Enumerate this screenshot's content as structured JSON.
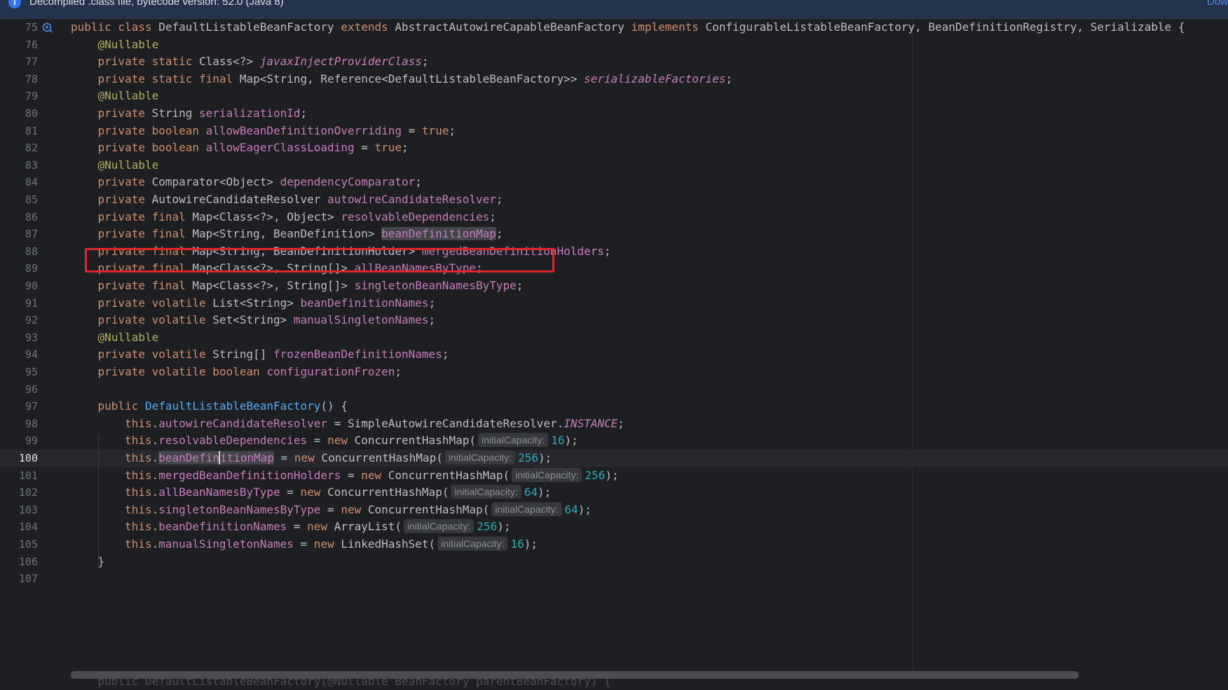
{
  "banner": {
    "icon": "info-icon",
    "text": "Decompiled .class file, bytecode version: 52.0 (Java 8)",
    "link": "Dow"
  },
  "editor": {
    "current_line": 100,
    "lines": [
      {
        "n": "75",
        "icon": true,
        "t": [
          [
            "kw",
            "public class "
          ],
          [
            "",
            "DefaultListableBeanFactory "
          ],
          [
            "kw",
            "extends "
          ],
          [
            "",
            "AbstractAutowireCapableBeanFactory "
          ],
          [
            "kw",
            "implements "
          ],
          [
            "",
            "ConfigurableListableBeanFactory, BeanDefinitionRegistry, Serializable {"
          ]
        ]
      },
      {
        "n": "76",
        "t": [
          [
            "",
            "    "
          ],
          [
            "ann",
            "@Nullable"
          ]
        ]
      },
      {
        "n": "77",
        "t": [
          [
            "",
            "    "
          ],
          [
            "kw",
            "private static "
          ],
          [
            "",
            "Class<?> "
          ],
          [
            "sfld",
            "javaxInjectProviderClass"
          ],
          [
            "",
            ";"
          ]
        ]
      },
      {
        "n": "78",
        "t": [
          [
            "",
            "    "
          ],
          [
            "kw",
            "private static final "
          ],
          [
            "",
            "Map<String, Reference<DefaultListableBeanFactory>> "
          ],
          [
            "sfld",
            "serializableFactories"
          ],
          [
            "",
            ";"
          ]
        ]
      },
      {
        "n": "79",
        "t": [
          [
            "",
            "    "
          ],
          [
            "ann",
            "@Nullable"
          ]
        ]
      },
      {
        "n": "80",
        "t": [
          [
            "",
            "    "
          ],
          [
            "kw",
            "private "
          ],
          [
            "",
            "String "
          ],
          [
            "fld",
            "serializationId"
          ],
          [
            "",
            ";"
          ]
        ]
      },
      {
        "n": "81",
        "t": [
          [
            "",
            "    "
          ],
          [
            "kw",
            "private boolean "
          ],
          [
            "fld",
            "allowBeanDefinitionOverriding"
          ],
          [
            "",
            " = "
          ],
          [
            "kw",
            "true"
          ],
          [
            "",
            ";"
          ]
        ]
      },
      {
        "n": "82",
        "t": [
          [
            "",
            "    "
          ],
          [
            "kw",
            "private boolean "
          ],
          [
            "fld",
            "allowEagerClassLoading"
          ],
          [
            "",
            " = "
          ],
          [
            "kw",
            "true"
          ],
          [
            "",
            ";"
          ]
        ]
      },
      {
        "n": "83",
        "t": [
          [
            "",
            "    "
          ],
          [
            "ann",
            "@Nullable"
          ]
        ]
      },
      {
        "n": "84",
        "t": [
          [
            "",
            "    "
          ],
          [
            "kw",
            "private "
          ],
          [
            "",
            "Comparator<Object> "
          ],
          [
            "fld",
            "dependencyComparator"
          ],
          [
            "",
            ";"
          ]
        ]
      },
      {
        "n": "85",
        "t": [
          [
            "",
            "    "
          ],
          [
            "kw",
            "private "
          ],
          [
            "",
            "AutowireCandidateResolver "
          ],
          [
            "fld",
            "autowireCandidateResolver"
          ],
          [
            "",
            ";"
          ]
        ]
      },
      {
        "n": "86",
        "t": [
          [
            "",
            "    "
          ],
          [
            "kw",
            "private final "
          ],
          [
            "",
            "Map<Class<?>, Object> "
          ],
          [
            "fld",
            "resolvableDependencies"
          ],
          [
            "",
            ";"
          ]
        ]
      },
      {
        "n": "87",
        "t": [
          [
            "",
            "    "
          ],
          [
            "kw",
            "private final "
          ],
          [
            "",
            "Map<String, BeanDefinition> "
          ],
          [
            "fld hl",
            "beanDefinitionMap"
          ],
          [
            "",
            ";"
          ]
        ]
      },
      {
        "n": "88",
        "t": [
          [
            "",
            "    "
          ],
          [
            "kw",
            "private final "
          ],
          [
            "",
            "Map<String, BeanDefinitionHolder> "
          ],
          [
            "fld",
            "mergedBeanDefinitionHolders"
          ],
          [
            "",
            ";"
          ]
        ]
      },
      {
        "n": "89",
        "t": [
          [
            "",
            "    "
          ],
          [
            "kw",
            "private final "
          ],
          [
            "",
            "Map<Class<?>, String[]> "
          ],
          [
            "fld",
            "allBeanNamesByType"
          ],
          [
            "",
            ";"
          ]
        ]
      },
      {
        "n": "90",
        "t": [
          [
            "",
            "    "
          ],
          [
            "kw",
            "private final "
          ],
          [
            "",
            "Map<Class<?>, String[]> "
          ],
          [
            "fld",
            "singletonBeanNamesByType"
          ],
          [
            "",
            ";"
          ]
        ]
      },
      {
        "n": "91",
        "t": [
          [
            "",
            "    "
          ],
          [
            "kw",
            "private volatile "
          ],
          [
            "",
            "List<String> "
          ],
          [
            "fld",
            "beanDefinitionNames"
          ],
          [
            "",
            ";"
          ]
        ]
      },
      {
        "n": "92",
        "t": [
          [
            "",
            "    "
          ],
          [
            "kw",
            "private volatile "
          ],
          [
            "",
            "Set<String> "
          ],
          [
            "fld",
            "manualSingletonNames"
          ],
          [
            "",
            ";"
          ]
        ]
      },
      {
        "n": "93",
        "t": [
          [
            "",
            "    "
          ],
          [
            "ann",
            "@Nullable"
          ]
        ]
      },
      {
        "n": "94",
        "t": [
          [
            "",
            "    "
          ],
          [
            "kw",
            "private volatile "
          ],
          [
            "",
            "String[] "
          ],
          [
            "fld",
            "frozenBeanDefinitionNames"
          ],
          [
            "",
            ";"
          ]
        ]
      },
      {
        "n": "95",
        "t": [
          [
            "",
            "    "
          ],
          [
            "kw",
            "private volatile boolean "
          ],
          [
            "fld",
            "configurationFrozen"
          ],
          [
            "",
            ";"
          ]
        ]
      },
      {
        "n": "96",
        "t": []
      },
      {
        "n": "97",
        "t": [
          [
            "",
            "    "
          ],
          [
            "kw",
            "public "
          ],
          [
            "fn",
            "DefaultListableBeanFactory"
          ],
          [
            "",
            "() {"
          ]
        ]
      },
      {
        "n": "98",
        "t": [
          [
            "",
            "        "
          ],
          [
            "kw",
            "this"
          ],
          [
            "",
            "."
          ],
          [
            "fld",
            "autowireCandidateResolver"
          ],
          [
            "",
            " = SimpleAutowireCandidateResolver."
          ],
          [
            "sfld",
            "INSTANCE"
          ],
          [
            "",
            ";"
          ]
        ]
      },
      {
        "n": "99",
        "t": [
          [
            "",
            "        "
          ],
          [
            "kw",
            "this"
          ],
          [
            "",
            "."
          ],
          [
            "fld",
            "resolvableDependencies"
          ],
          [
            "",
            " = "
          ],
          [
            "kw",
            "new "
          ],
          [
            "",
            "ConcurrentHashMap("
          ],
          [
            "hint",
            "initialCapacity:"
          ],
          [
            "num",
            "16"
          ],
          [
            "",
            ");"
          ]
        ]
      },
      {
        "n": "100",
        "t": [
          [
            "",
            "        "
          ],
          [
            "kw",
            "this"
          ],
          [
            "",
            "."
          ],
          [
            "fld hl",
            "beanDefin"
          ],
          [
            "caret",
            ""
          ],
          [
            "fld hl",
            "itionMap"
          ],
          [
            "",
            " = "
          ],
          [
            "kw",
            "new "
          ],
          [
            "",
            "ConcurrentHashMap("
          ],
          [
            "hint",
            "initialCapacity:"
          ],
          [
            "num",
            "256"
          ],
          [
            "",
            ");"
          ]
        ]
      },
      {
        "n": "101",
        "t": [
          [
            "",
            "        "
          ],
          [
            "kw",
            "this"
          ],
          [
            "",
            "."
          ],
          [
            "fld",
            "mergedBeanDefinitionHolders"
          ],
          [
            "",
            " = "
          ],
          [
            "kw",
            "new "
          ],
          [
            "",
            "ConcurrentHashMap("
          ],
          [
            "hint",
            "initialCapacity:"
          ],
          [
            "num",
            "256"
          ],
          [
            "",
            ");"
          ]
        ]
      },
      {
        "n": "102",
        "t": [
          [
            "",
            "        "
          ],
          [
            "kw",
            "this"
          ],
          [
            "",
            "."
          ],
          [
            "fld",
            "allBeanNamesByType"
          ],
          [
            "",
            " = "
          ],
          [
            "kw",
            "new "
          ],
          [
            "",
            "ConcurrentHashMap("
          ],
          [
            "hint",
            "initialCapacity:"
          ],
          [
            "num",
            "64"
          ],
          [
            "",
            ");"
          ]
        ]
      },
      {
        "n": "103",
        "t": [
          [
            "",
            "        "
          ],
          [
            "kw",
            "this"
          ],
          [
            "",
            "."
          ],
          [
            "fld",
            "singletonBeanNamesByType"
          ],
          [
            "",
            " = "
          ],
          [
            "kw",
            "new "
          ],
          [
            "",
            "ConcurrentHashMap("
          ],
          [
            "hint",
            "initialCapacity:"
          ],
          [
            "num",
            "64"
          ],
          [
            "",
            ");"
          ]
        ]
      },
      {
        "n": "104",
        "t": [
          [
            "",
            "        "
          ],
          [
            "kw",
            "this"
          ],
          [
            "",
            "."
          ],
          [
            "fld",
            "beanDefinitionNames"
          ],
          [
            "",
            " = "
          ],
          [
            "kw",
            "new "
          ],
          [
            "",
            "ArrayList("
          ],
          [
            "hint",
            "initialCapacity:"
          ],
          [
            "num",
            "256"
          ],
          [
            "",
            ");"
          ]
        ]
      },
      {
        "n": "105",
        "t": [
          [
            "",
            "        "
          ],
          [
            "kw",
            "this"
          ],
          [
            "",
            "."
          ],
          [
            "fld",
            "manualSingletonNames"
          ],
          [
            "",
            " = "
          ],
          [
            "kw",
            "new "
          ],
          [
            "",
            "LinkedHashSet("
          ],
          [
            "hint",
            "initialCapacity:"
          ],
          [
            "num",
            "16"
          ],
          [
            "",
            ");"
          ]
        ]
      },
      {
        "n": "106",
        "t": [
          [
            "",
            "    }"
          ]
        ]
      },
      {
        "n": "107",
        "t": []
      }
    ],
    "partial_line": "    public DefaultListableBeanFactory(@Nullable BeanFactory parentBeanFactory) {"
  },
  "colors": {
    "background": "#1e1f22",
    "keyword": "#cf8e6d",
    "annotation": "#b3ae60",
    "field": "#c77dbb",
    "method": "#56a8f5",
    "number": "#2aacb8",
    "highlight_box": "#e0262a"
  }
}
